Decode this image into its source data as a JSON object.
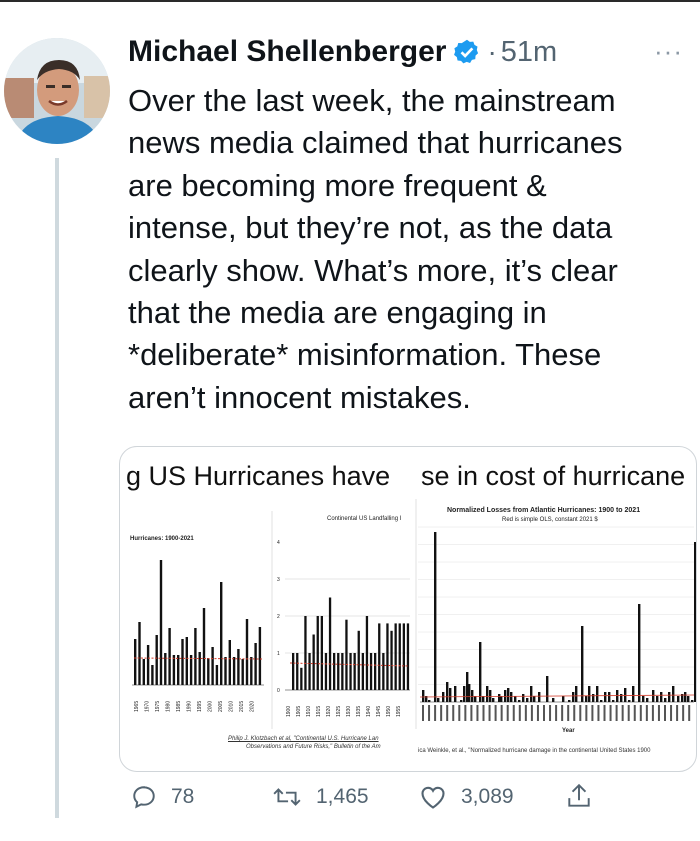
{
  "author": {
    "name": "Michael Shellenberger",
    "separator": "·",
    "time": "51m"
  },
  "more_label": "···",
  "tweet": {
    "lines": [
      "Over the last week, the mainstream",
      "news media claimed that hurricanes",
      "are becoming more frequent &",
      "intense, but they’re not, as the data",
      "clearly show. What’s more, it’s clear",
      "that the media are engaging in",
      "*deliberate* misinformation. These",
      "aren’t innocent mistakes."
    ]
  },
  "media": {
    "title_left": "g US Hurricanes have",
    "title_right": "se in cost of hurricane",
    "panel1": {
      "title": "Hurricanes: 1900-2021",
      "x_ticks": [
        "1965",
        "1970",
        "1975",
        "1980",
        "1985",
        "1990",
        "1995",
        "2000",
        "2005",
        "2010",
        "2015",
        "2020"
      ]
    },
    "panel2": {
      "title": "Continental US Landfalling I",
      "y_ticks": [
        "4",
        "3",
        "2",
        "1",
        "0"
      ],
      "x_ticks": [
        "1900",
        "1905",
        "1910",
        "1915",
        "1920",
        "1925",
        "1930",
        "1935",
        "1940",
        "1945",
        "1950",
        "1955"
      ],
      "credit_line1": "Philip J. Klotzbach et al, \"Continental U.S. Hurricane Lan",
      "credit_line2": "Observations and Future Risks,\" Bulletin of the Am"
    },
    "panel3": {
      "title": "Normalized Losses from Atlantic Hurricanes: 1900 to 2021",
      "subtitle": "Red is simple OLS, constant 2021 $",
      "x_label": "Year",
      "credit": "ica Weinkle, et al., \"Normalized hurricane damage in the continental United States 1900"
    },
    "colors": {
      "bars": "#111111",
      "trend": "#d23b2a",
      "grid": "#bfbfbf"
    }
  },
  "actions": {
    "reply_count": "78",
    "retweet_count": "1,465",
    "like_count": "3,089"
  },
  "icons": [
    "verified-badge-icon",
    "reply-icon",
    "retweet-icon",
    "like-icon",
    "share-icon",
    "more-icon"
  ],
  "theme": {
    "verified_blue": "#1d9bf0",
    "muted": "#536471"
  }
}
